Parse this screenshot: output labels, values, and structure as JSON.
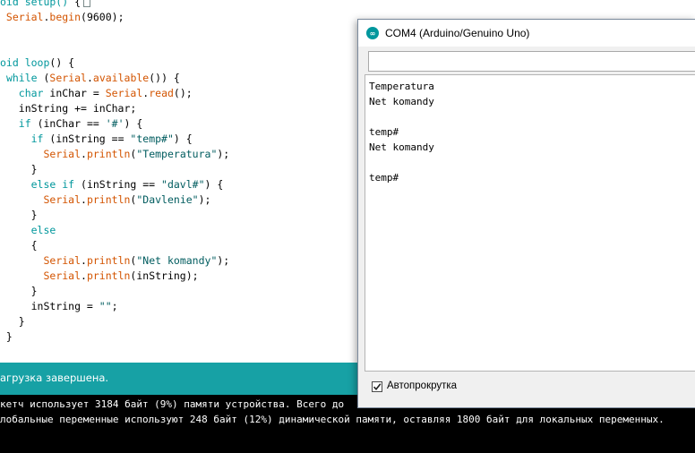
{
  "editor": {
    "lines": [
      {
        "segments": [
          {
            "t": "oid setup() ",
            "c": "kw"
          },
          {
            "t": "{",
            "c": "plain"
          }
        ],
        "cursor": true
      },
      {
        "segments": [
          {
            "t": " Serial",
            "c": "fn"
          },
          {
            "t": ".",
            "c": "plain"
          },
          {
            "t": "begin",
            "c": "fn"
          },
          {
            "t": "(9600);",
            "c": "plain"
          }
        ]
      },
      {
        "segments": []
      },
      {
        "segments": []
      },
      {
        "segments": [
          {
            "t": "oid ",
            "c": "kw"
          },
          {
            "t": "loop",
            "c": "kw"
          },
          {
            "t": "() {",
            "c": "plain"
          }
        ]
      },
      {
        "segments": [
          {
            "t": " ",
            "c": "plain"
          },
          {
            "t": "while",
            "c": "kw"
          },
          {
            "t": " (",
            "c": "plain"
          },
          {
            "t": "Serial",
            "c": "fn"
          },
          {
            "t": ".",
            "c": "plain"
          },
          {
            "t": "available",
            "c": "fn"
          },
          {
            "t": "()) {",
            "c": "plain"
          }
        ]
      },
      {
        "segments": [
          {
            "t": "   ",
            "c": "plain"
          },
          {
            "t": "char",
            "c": "kw"
          },
          {
            "t": " inChar = ",
            "c": "plain"
          },
          {
            "t": "Serial",
            "c": "fn"
          },
          {
            "t": ".",
            "c": "plain"
          },
          {
            "t": "read",
            "c": "fn"
          },
          {
            "t": "();",
            "c": "plain"
          }
        ]
      },
      {
        "segments": [
          {
            "t": "   inString += inChar;",
            "c": "plain"
          }
        ]
      },
      {
        "segments": [
          {
            "t": "   ",
            "c": "plain"
          },
          {
            "t": "if",
            "c": "kw"
          },
          {
            "t": " (inChar == ",
            "c": "plain"
          },
          {
            "t": "'#'",
            "c": "str"
          },
          {
            "t": ") {",
            "c": "plain"
          }
        ]
      },
      {
        "segments": [
          {
            "t": "     ",
            "c": "plain"
          },
          {
            "t": "if",
            "c": "kw"
          },
          {
            "t": " (inString == ",
            "c": "plain"
          },
          {
            "t": "\"temp#\"",
            "c": "str"
          },
          {
            "t": ") {",
            "c": "plain"
          }
        ]
      },
      {
        "segments": [
          {
            "t": "       ",
            "c": "plain"
          },
          {
            "t": "Serial",
            "c": "fn"
          },
          {
            "t": ".",
            "c": "plain"
          },
          {
            "t": "println",
            "c": "fn"
          },
          {
            "t": "(",
            "c": "plain"
          },
          {
            "t": "\"Temperatura\"",
            "c": "str"
          },
          {
            "t": ");",
            "c": "plain"
          }
        ]
      },
      {
        "segments": [
          {
            "t": "     }",
            "c": "plain"
          }
        ]
      },
      {
        "segments": [
          {
            "t": "     ",
            "c": "plain"
          },
          {
            "t": "else if",
            "c": "kw"
          },
          {
            "t": " (inString == ",
            "c": "plain"
          },
          {
            "t": "\"davl#\"",
            "c": "str"
          },
          {
            "t": ") {",
            "c": "plain"
          }
        ]
      },
      {
        "segments": [
          {
            "t": "       ",
            "c": "plain"
          },
          {
            "t": "Serial",
            "c": "fn"
          },
          {
            "t": ".",
            "c": "plain"
          },
          {
            "t": "println",
            "c": "fn"
          },
          {
            "t": "(",
            "c": "plain"
          },
          {
            "t": "\"Davlenie\"",
            "c": "str"
          },
          {
            "t": ");",
            "c": "plain"
          }
        ]
      },
      {
        "segments": [
          {
            "t": "     }",
            "c": "plain"
          }
        ]
      },
      {
        "segments": [
          {
            "t": "     ",
            "c": "plain"
          },
          {
            "t": "else",
            "c": "kw"
          }
        ]
      },
      {
        "segments": [
          {
            "t": "     {",
            "c": "plain"
          }
        ]
      },
      {
        "segments": [
          {
            "t": "       ",
            "c": "plain"
          },
          {
            "t": "Serial",
            "c": "fn"
          },
          {
            "t": ".",
            "c": "plain"
          },
          {
            "t": "println",
            "c": "fn"
          },
          {
            "t": "(",
            "c": "plain"
          },
          {
            "t": "\"Net komandy\"",
            "c": "str"
          },
          {
            "t": ");",
            "c": "plain"
          }
        ]
      },
      {
        "segments": [
          {
            "t": "       ",
            "c": "plain"
          },
          {
            "t": "Serial",
            "c": "fn"
          },
          {
            "t": ".",
            "c": "plain"
          },
          {
            "t": "println",
            "c": "fn"
          },
          {
            "t": "(inString);",
            "c": "plain"
          }
        ]
      },
      {
        "segments": [
          {
            "t": "     }",
            "c": "plain"
          }
        ]
      },
      {
        "segments": [
          {
            "t": "     inString = ",
            "c": "plain"
          },
          {
            "t": "\"\"",
            "c": "str"
          },
          {
            "t": ";",
            "c": "plain"
          }
        ]
      },
      {
        "segments": [
          {
            "t": "   }",
            "c": "plain"
          }
        ]
      },
      {
        "segments": [
          {
            "t": " }",
            "c": "plain"
          }
        ]
      }
    ]
  },
  "status_bar": {
    "text": "агрузка завершена."
  },
  "console": {
    "lines": [
      "кетч использует 3184 байт (9%) памяти устройства. Всего до",
      "лобальные переменные используют 248 байт (12%) динамической памяти, оставляя 1800 байт для локальных переменных."
    ]
  },
  "serial_monitor": {
    "title": "COM4 (Arduino/Genuino Uno)",
    "input_value": "",
    "output_lines": [
      "Temperatura",
      "Net komandy",
      "",
      "temp#",
      "Net komandy",
      "",
      "temp#"
    ],
    "autoscroll_label": "Автопрокрутка",
    "autoscroll_checked": true
  },
  "colors": {
    "keyword": "#00979c",
    "function": "#d35400",
    "string": "#005c5f",
    "status_bar": "#17a1a5",
    "console_bg": "#000000"
  }
}
